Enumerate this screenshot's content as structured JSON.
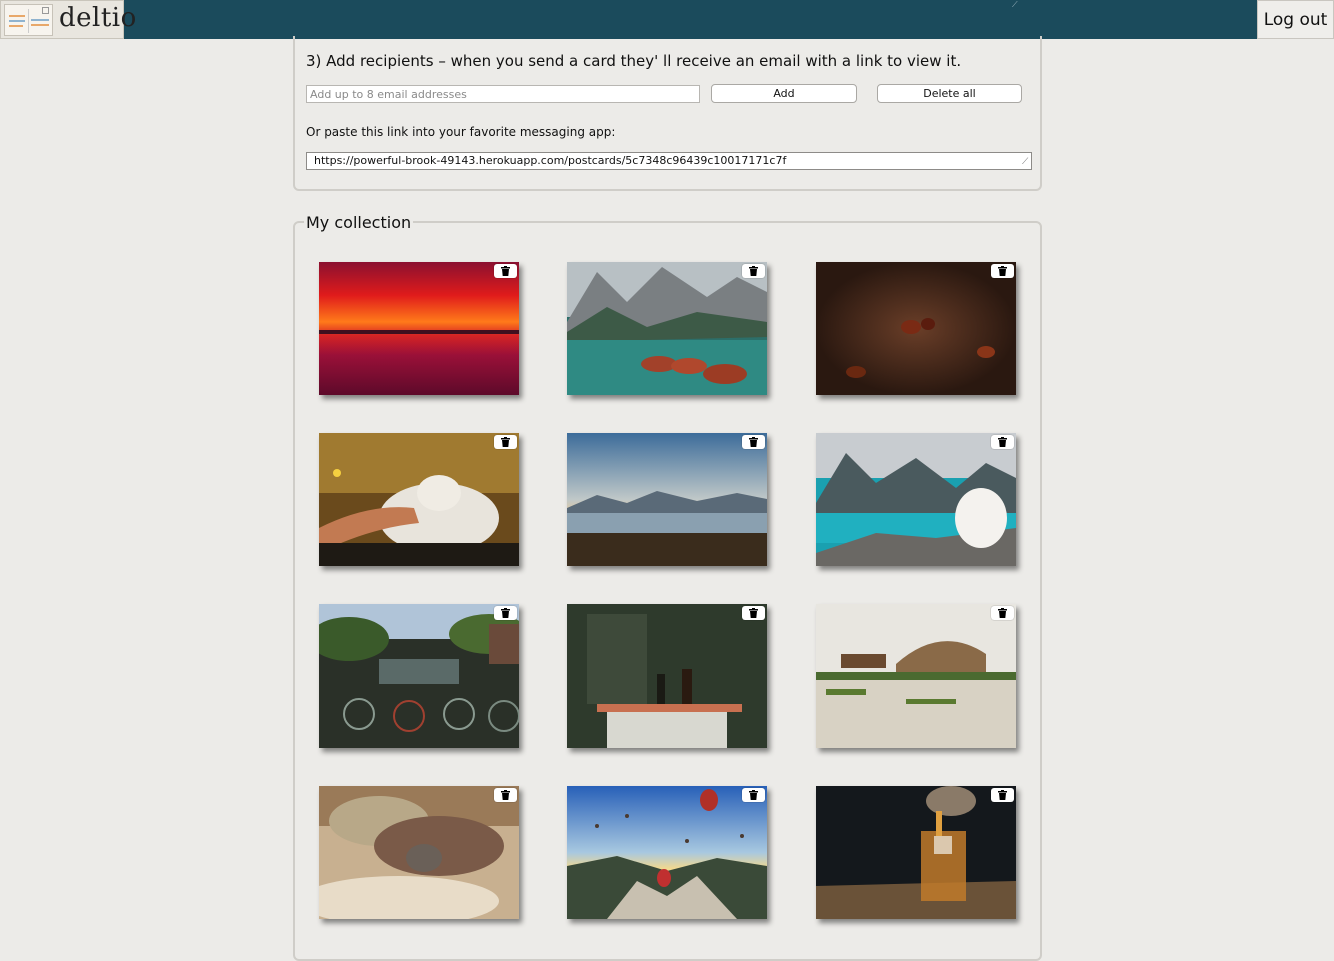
{
  "app": {
    "logo_text": "deltio",
    "logout_label": "Log out"
  },
  "recipients": {
    "title": "3) Add recipients – when you send a card they' ll receive an email with a link to view it.",
    "email_placeholder": "Add up to 8 email addresses",
    "add_label": "Add",
    "delete_all_label": "Delete all",
    "paste_label": "Or paste this link into your favorite messaging app:",
    "share_link": "https://powerful-brook-49143.herokuapp.com/postcards/5c7348c96439c10017171c7f"
  },
  "collection": {
    "legend": "My collection",
    "cards": [
      {
        "subject": "sunset over sea",
        "icon": "trash-icon"
      },
      {
        "subject": "rowboats on mountain lake",
        "icon": "trash-icon"
      },
      {
        "subject": "ant close-up",
        "icon": "trash-icon"
      },
      {
        "subject": "cat being petted",
        "icon": "trash-icon"
      },
      {
        "subject": "mountain lake landscape",
        "icon": "trash-icon"
      },
      {
        "subject": "white dog by turquoise lake",
        "icon": "trash-icon"
      },
      {
        "subject": "bicycles by canal",
        "icon": "trash-icon"
      },
      {
        "subject": "dark room with bottles",
        "icon": "trash-icon"
      },
      {
        "subject": "houseboat on water",
        "icon": "trash-icon"
      },
      {
        "subject": "cat under blanket",
        "icon": "trash-icon"
      },
      {
        "subject": "hot air balloons",
        "icon": "trash-icon"
      },
      {
        "subject": "whisky pour",
        "icon": "trash-icon"
      }
    ]
  },
  "colors": {
    "topbar": "#1b4b5c",
    "page_bg": "#ecebe8",
    "panel_border": "#cfcdc8"
  }
}
